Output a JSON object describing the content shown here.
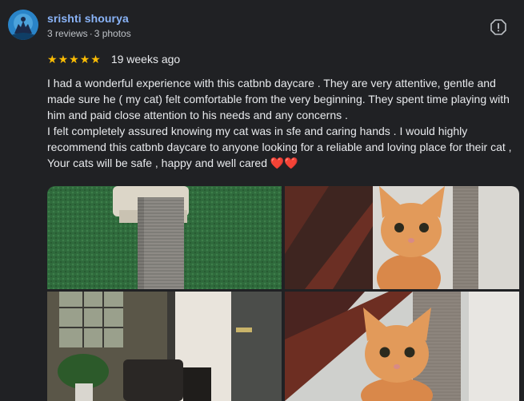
{
  "reviewer": {
    "name": "srishti shourya",
    "reviews_count": "3 reviews",
    "photos_count": "3 photos"
  },
  "rating": {
    "stars": 5,
    "time": "19 weeks ago"
  },
  "review": {
    "para1": "I had a wonderful experience with this catbnb daycare . They are very attentive, gentle and made sure he ( my cat) felt comfortable from the very beginning. They spent time playing with him and paid close attention to his needs and any concerns .",
    "para2": "I felt completely assured knowing my cat was in sfe and caring hands . I would highly recommend this catbnb daycare to anyone looking for a reliable and loving place for their cat , Your cats will be safe , happy and well cared",
    "hearts": "❤️❤️"
  },
  "icons": {
    "report": "report-icon",
    "star": "star-icon"
  },
  "colors": {
    "name": "#8ab4f8",
    "star": "#fbbc04",
    "background": "#202124"
  }
}
